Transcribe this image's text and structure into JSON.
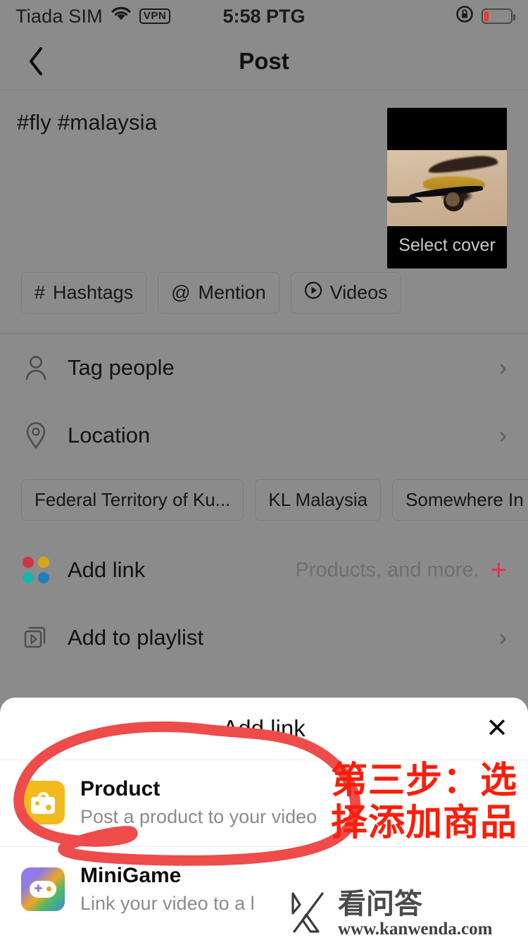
{
  "status_bar": {
    "carrier": "Tiada SIM",
    "wifi_icon": "wifi-icon",
    "vpn_label": "VPN",
    "time": "5:58 PTG",
    "rotation_lock_icon": "rotation-lock-icon",
    "battery_icon": "battery-low-icon",
    "battery_level_percent": 18,
    "battery_color": "#ef3b2d"
  },
  "navbar": {
    "back_icon": "chevron-left-icon",
    "title": "Post"
  },
  "caption": {
    "text": "#fly #malaysia",
    "cover": {
      "label": "Select cover"
    }
  },
  "caption_chips": [
    {
      "icon": "hashtag-icon",
      "glyph": "#",
      "label": "Hashtags"
    },
    {
      "icon": "at-icon",
      "glyph": "@",
      "label": "Mention"
    },
    {
      "icon": "video-play-icon",
      "glyph": "▷",
      "label": "Videos"
    }
  ],
  "rows": {
    "tag_people": {
      "icon": "person-icon",
      "label": "Tag people",
      "chevron": "›"
    },
    "location": {
      "icon": "location-pin-icon",
      "label": "Location",
      "chevron": "›"
    },
    "add_link": {
      "icon": "four-dots-icon",
      "label": "Add link",
      "hint": "Products, and more.",
      "plus": "+",
      "plus_color": "#e8304a",
      "dot_colors": [
        "#d1344a",
        "#d6a51c",
        "#16b5ae",
        "#1d7fc0"
      ]
    },
    "add_to_playlist": {
      "icon": "playlist-icon",
      "label": "Add to playlist",
      "chevron": "›"
    }
  },
  "location_chips": [
    {
      "label": "Federal Territory of Ku..."
    },
    {
      "label": "KL Malaysia"
    },
    {
      "label": "Somewhere In Earth"
    }
  ],
  "sheet": {
    "title": "Add link",
    "close_icon": "close-icon",
    "close_glyph": "✕",
    "options": [
      {
        "icon": "product-bag-icon",
        "icon_color": "#f2bb1d",
        "title": "Product",
        "subtitle": "Post a product to your video"
      },
      {
        "icon": "minigame-gamepad-icon",
        "icon_color": "#8e7ce0",
        "title": "MiniGame",
        "subtitle": "Link your video to a l"
      }
    ]
  },
  "annotation": {
    "circle_color": "#ee4b4b",
    "text_color": "#fb1e0a",
    "line1": "第三步：选",
    "line2": "择添加商品"
  },
  "watermark": {
    "logo": "k-logo-icon",
    "cn_text": "看问答",
    "url": "www.kanwenda.com"
  }
}
